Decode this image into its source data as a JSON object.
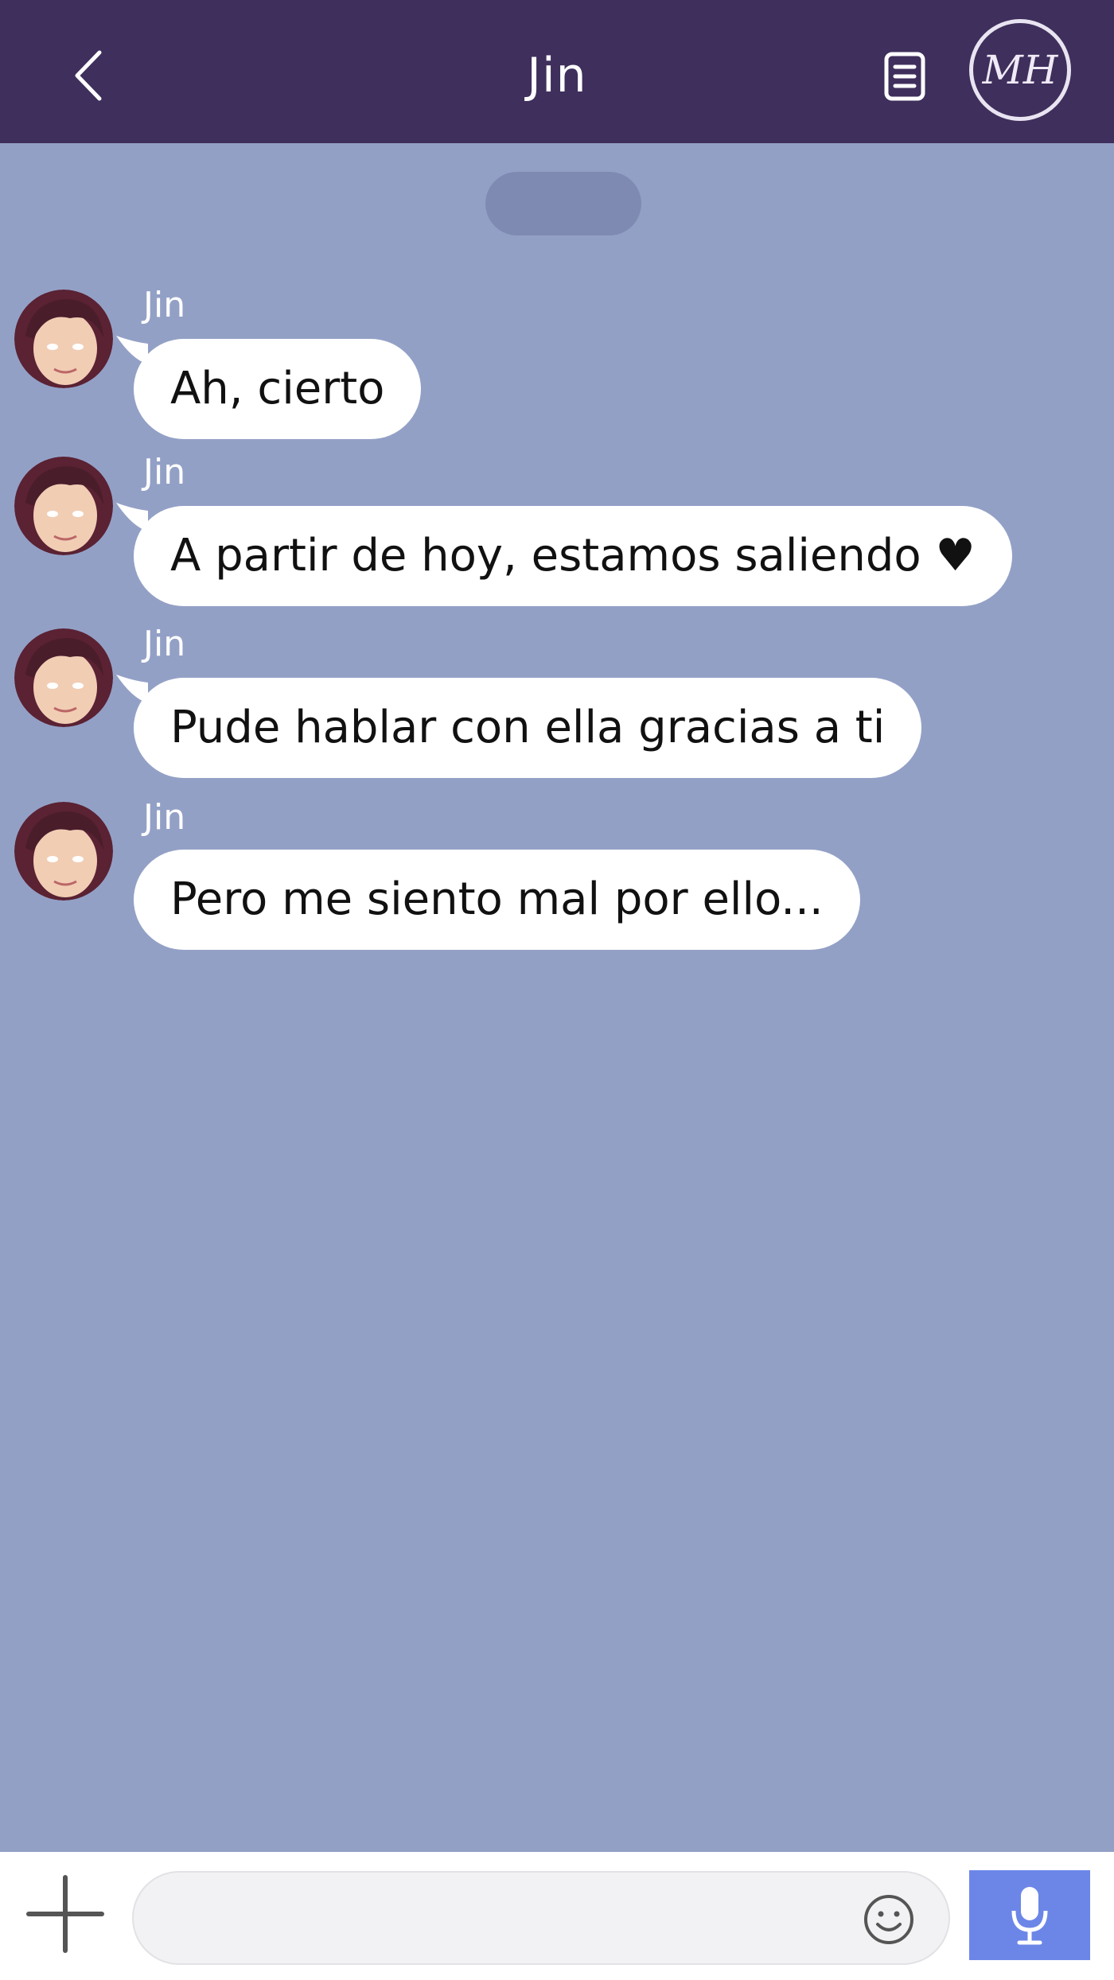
{
  "header": {
    "title": "Jin",
    "back_icon": "chevron-left-icon",
    "notes_icon": "document-icon",
    "profile_monogram": "MH"
  },
  "messages": [
    {
      "sender": "Jin",
      "text": "Ah, cierto"
    },
    {
      "sender": "Jin",
      "text": "A partir de hoy, estamos saliendo ♥"
    },
    {
      "sender": "Jin",
      "text": "Pude hablar con ella gracias a ti"
    },
    {
      "sender": "Jin",
      "text": "Pero me siento mal por ello..."
    }
  ],
  "composer": {
    "input_value": "",
    "add_icon": "plus-icon",
    "emoji_icon": "smiley-icon",
    "mic_icon": "microphone-icon"
  },
  "colors": {
    "header_bg": "#3f2f5c",
    "chat_bg": "#93a0c6",
    "bubble_bg": "#ffffff",
    "mic_button": "#6c86e8"
  }
}
